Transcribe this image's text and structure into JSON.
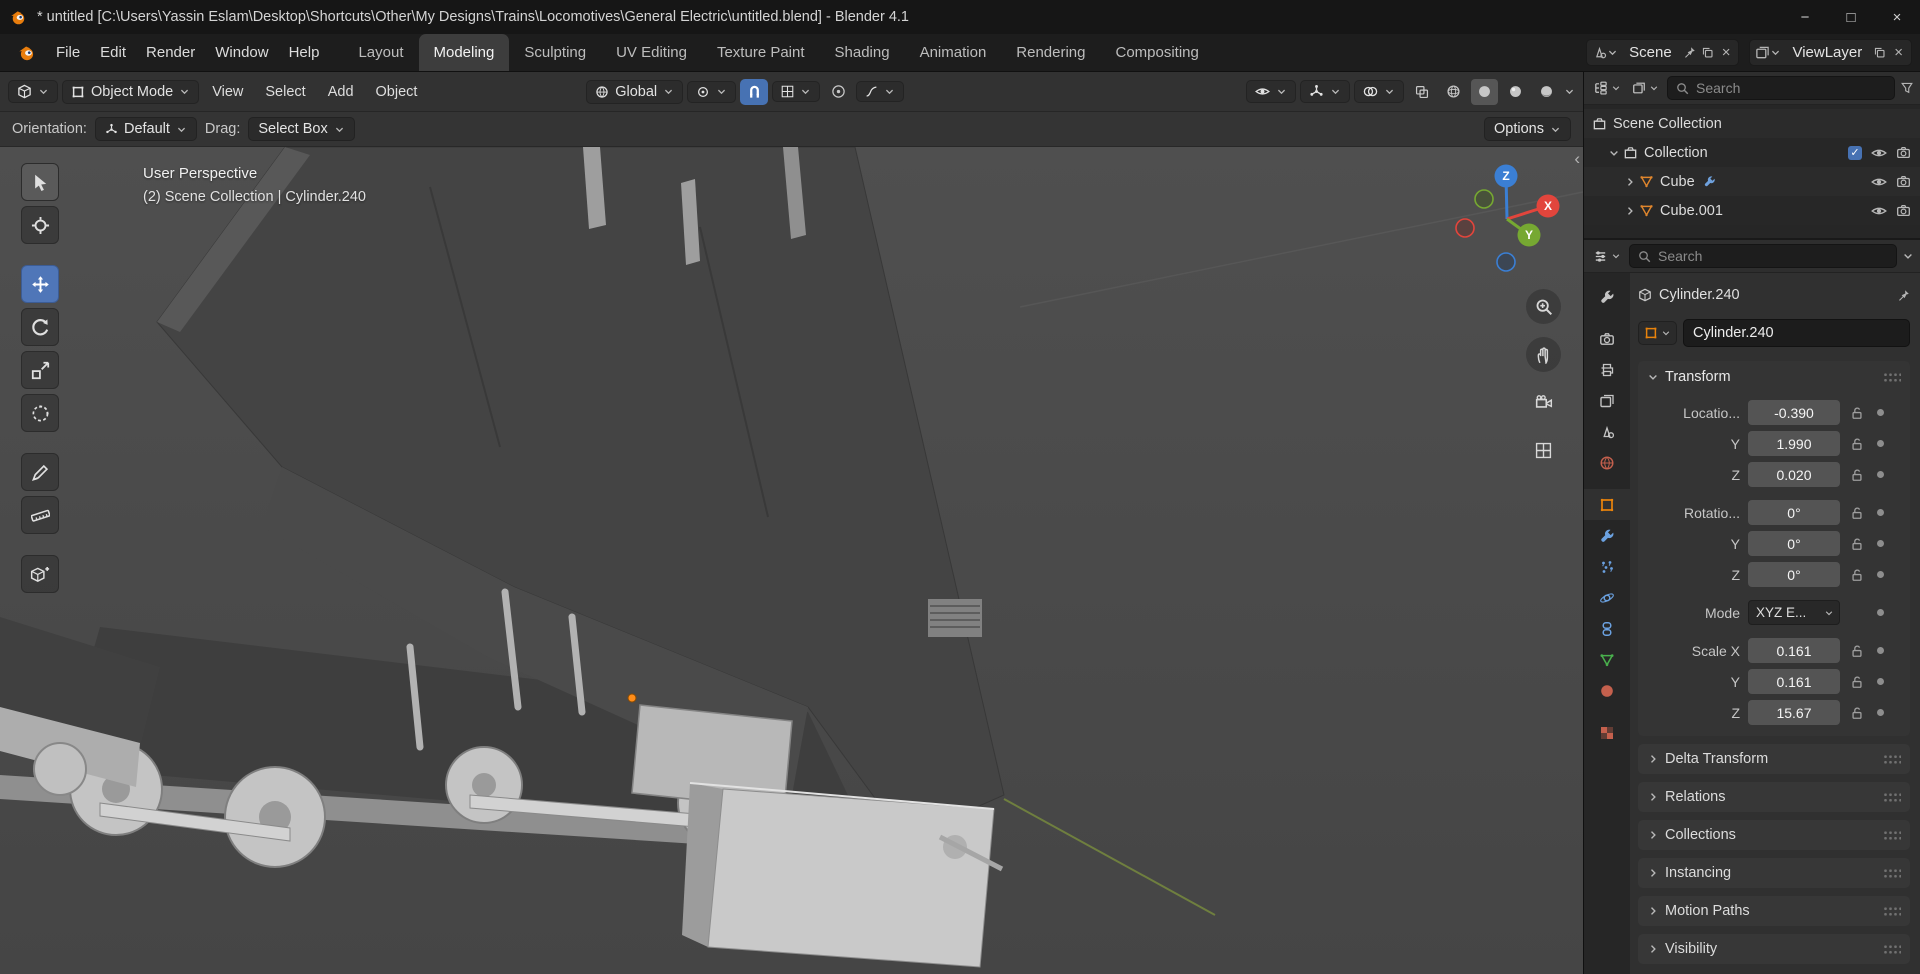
{
  "window": {
    "title": "* untitled [C:\\Users\\Yassin Eslam\\Desktop\\Shortcuts\\Other\\My Designs\\Trains\\Locomotives\\General Electric\\untitled.blend] - Blender 4.1"
  },
  "icons": {
    "minimize": "−",
    "maximize": "□",
    "close": "×",
    "unlink": "×",
    "collapse_left": "‹",
    "check": "✓"
  },
  "topbar": {
    "menus": [
      {
        "label": "File"
      },
      {
        "label": "Edit"
      },
      {
        "label": "Render"
      },
      {
        "label": "Window"
      },
      {
        "label": "Help"
      }
    ],
    "workspaces": [
      {
        "label": "Layout"
      },
      {
        "label": "Modeling"
      },
      {
        "label": "Sculpting"
      },
      {
        "label": "UV Editing"
      },
      {
        "label": "Texture Paint"
      },
      {
        "label": "Shading"
      },
      {
        "label": "Animation"
      },
      {
        "label": "Rendering"
      },
      {
        "label": "Compositing"
      }
    ],
    "active_workspace": "Modeling",
    "scene": {
      "label": "Scene"
    },
    "view_layer": {
      "label": "ViewLayer"
    }
  },
  "viewport_header": {
    "mode": "Object Mode",
    "menus": [
      {
        "label": "View"
      },
      {
        "label": "Select"
      },
      {
        "label": "Add"
      },
      {
        "label": "Object"
      }
    ],
    "orientation": "Global"
  },
  "tool_settings": {
    "orientation_label": "Orientation:",
    "orientation_value": "Default",
    "drag_label": "Drag:",
    "drag_value": "Select Box",
    "options": "Options"
  },
  "viewport": {
    "view_label": "User Perspective",
    "context_label": "(2) Scene Collection | Cylinder.240",
    "axes": {
      "x": "X",
      "y": "Y",
      "z": "Z"
    }
  },
  "colors": {
    "accent_blue": "#4772b3",
    "object_orange": "#e8830c",
    "axis_x": "#e2453c",
    "axis_y": "#76a832",
    "axis_z": "#3b7fd4"
  },
  "outliner": {
    "search_placeholder": "Search",
    "rows": [
      {
        "label": "Scene Collection"
      },
      {
        "label": "Collection"
      },
      {
        "label": "Cube"
      },
      {
        "label": "Cube.001"
      }
    ]
  },
  "properties": {
    "search_placeholder": "Search",
    "breadcrumb": "Cylinder.240",
    "name_value": "Cylinder.240",
    "transform": {
      "title": "Transform",
      "rows": [
        {
          "label": "Locatio...",
          "value": "-0.390"
        },
        {
          "label": "Y",
          "value": "1.990"
        },
        {
          "label": "Z",
          "value": "0.020"
        },
        {
          "label": "Rotatio...",
          "value": "0°"
        },
        {
          "label": "Y",
          "value": "0°"
        },
        {
          "label": "Z",
          "value": "0°"
        },
        {
          "label": "Mode",
          "value": "XYZ E..."
        },
        {
          "label": "Scale X",
          "value": "0.161"
        },
        {
          "label": "Y",
          "value": "0.161"
        },
        {
          "label": "Z",
          "value": "15.67"
        }
      ]
    },
    "panels": [
      {
        "label": "Delta Transform"
      },
      {
        "label": "Relations"
      },
      {
        "label": "Collections"
      },
      {
        "label": "Instancing"
      },
      {
        "label": "Motion Paths"
      },
      {
        "label": "Visibility"
      }
    ]
  }
}
